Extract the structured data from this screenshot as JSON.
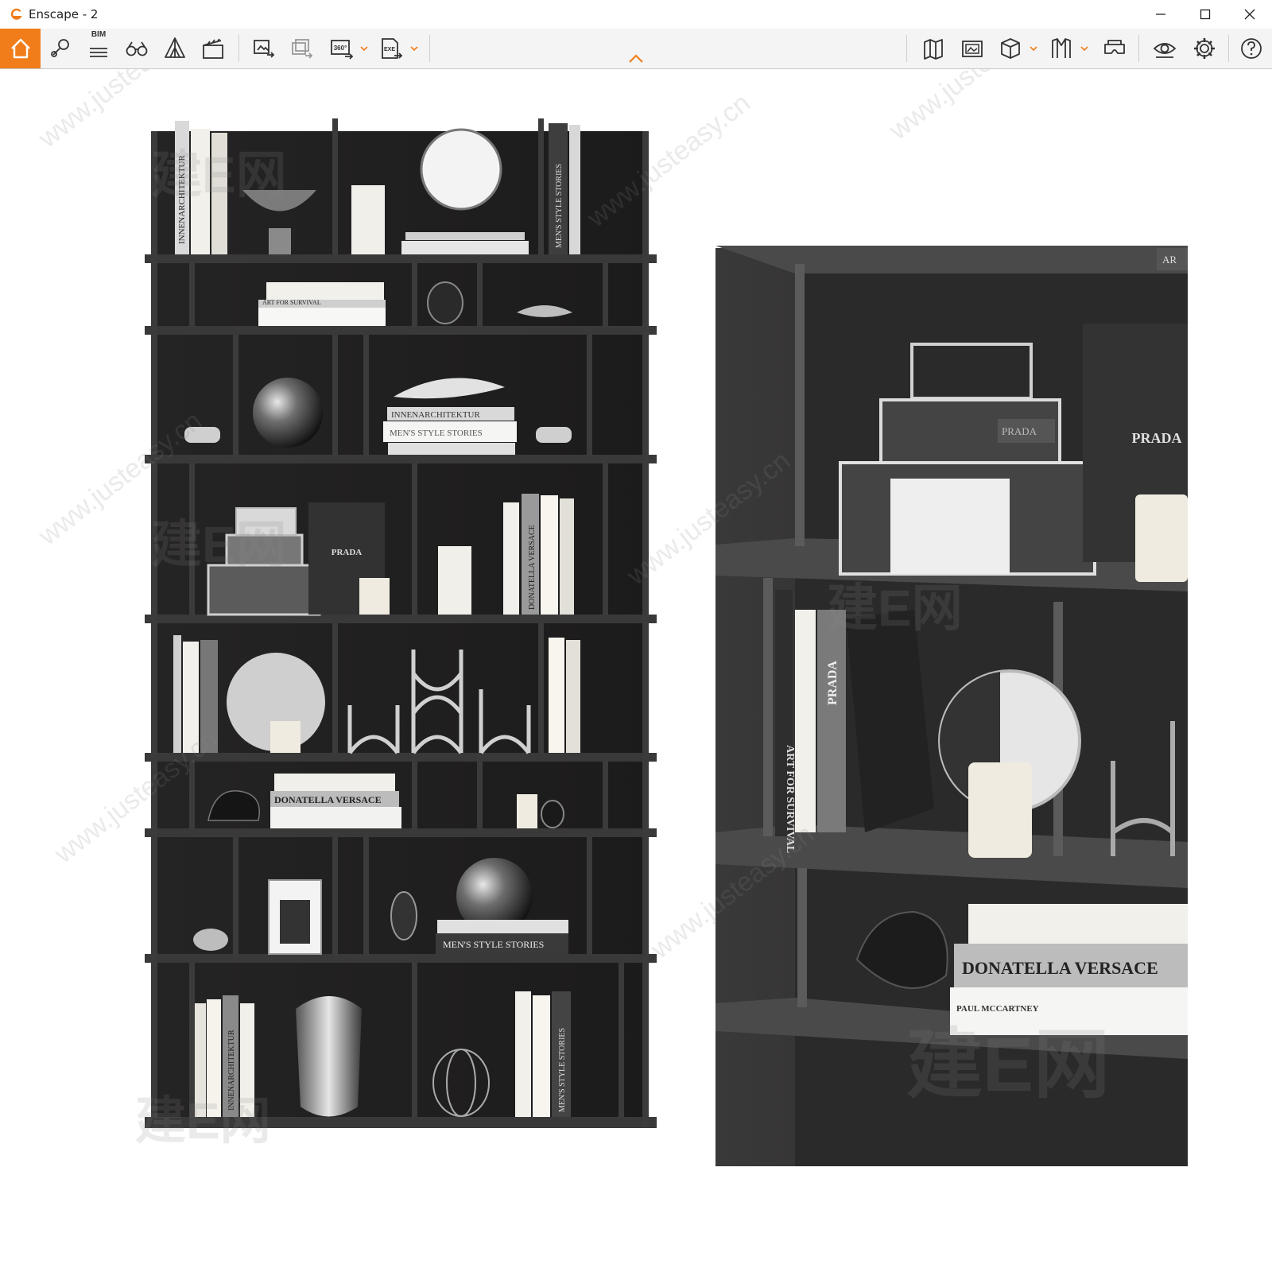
{
  "window": {
    "title": "Enscape - 2"
  },
  "toolbar": {
    "bim_label": "BIM",
    "view360_label": "360°",
    "export_label": "EXE"
  },
  "watermark": {
    "site": "www.justeasy.cn",
    "brand": "建E网"
  },
  "scene": {
    "left_books": [
      "INNENARCHITEKTUR",
      "MEN'S STYLE STORIES",
      "ART FOR SURVIVAL",
      "DONATELLA VERSACE",
      "PRADA"
    ],
    "right_books": [
      "PRADA",
      "PRADA",
      "ART FOR SURVIVAL",
      "PRADA",
      "DONATELLA VERSACE",
      "PAUL MCCARTNEY",
      "AR"
    ]
  },
  "colors": {
    "accent": "#f07d1a",
    "shelf_dark": "#2b2a2a",
    "shelf_edge": "#3c3b3b",
    "back_panel": "#1f1e1e"
  }
}
